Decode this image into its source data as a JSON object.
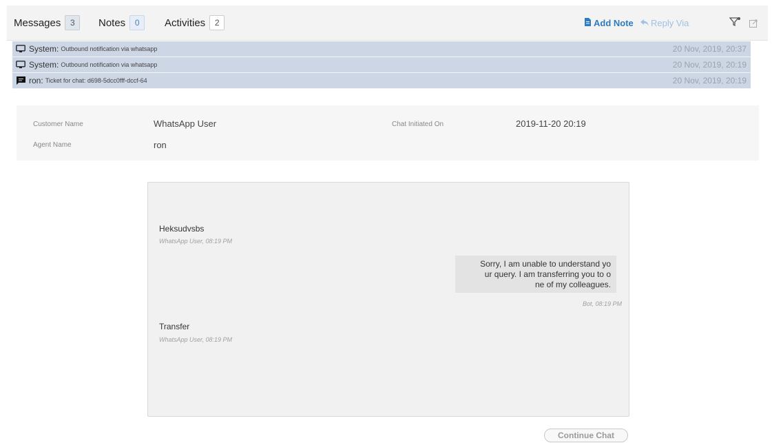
{
  "tabs": [
    {
      "label": "Messages",
      "count": "3"
    },
    {
      "label": "Notes",
      "count": "0"
    },
    {
      "label": "Activities",
      "count": "2"
    }
  ],
  "actions": {
    "add_note": "Add Note",
    "reply_via": "Reply Via"
  },
  "icons": {
    "filter": "filter-icon",
    "popout": "popout-icon",
    "system": "monitor-icon",
    "chat": "chat-bubble-icon",
    "note": "note-icon",
    "reply": "reply-icon"
  },
  "rows": [
    {
      "who": "System:",
      "message": "Outbound notification via whatsapp",
      "date": "20 Nov, 2019, 20:37"
    },
    {
      "who": "System:",
      "message": "Outbound notification via whatsapp",
      "date": "20 Nov, 2019, 20:19"
    },
    {
      "who": "ron:",
      "message": "Ticket for chat: d698-5dcc0fff-dccf-64",
      "date": "20 Nov, 2019, 20:19"
    }
  ],
  "info": {
    "customer_label": "Customer Name",
    "customer_value": "WhatsApp User",
    "agent_label": "Agent Name",
    "agent_value": "ron",
    "initiated_label": "Chat Initiated On",
    "initiated_value": "2019-11-20 20:19"
  },
  "chat": {
    "msg1_text": "Heksudvsbs",
    "msg1_meta": "WhatsApp User, 08:19 PM",
    "bot_line1": "Sorry, I am unable to understand yo",
    "bot_line2": "ur query. I am transferring you to o",
    "bot_line3": "ne of my colleagues.",
    "bot_meta": "Bot, 08:19 PM",
    "msg2_text": "Transfer",
    "msg2_meta": "WhatsApp User, 08:19 PM"
  },
  "continue_label": "Continue Chat",
  "colors": {
    "row_bg": "#cdd6e5",
    "accent": "#2e7bbf",
    "reply": "#9fc1e3"
  }
}
